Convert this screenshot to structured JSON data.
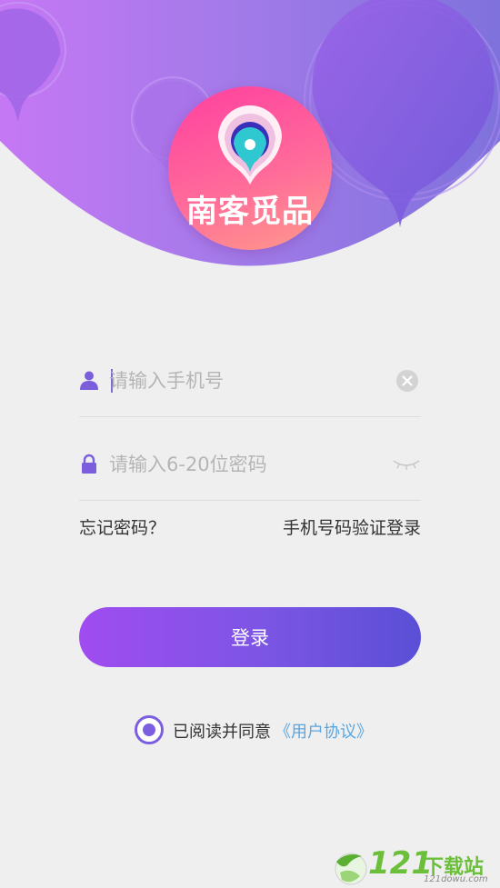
{
  "brand": {
    "name": "南客觅品",
    "colors": {
      "purple_start": "#c070f0",
      "purple_end": "#7f6ee0",
      "logo_pink": "#ff4fa0"
    }
  },
  "login": {
    "phone": {
      "placeholder": "请输入手机号",
      "value": ""
    },
    "password": {
      "placeholder": "请输入6-20位密码",
      "value": ""
    },
    "forgot_label": "忘记密码？",
    "sms_login_label": "手机号码验证登录",
    "submit_label": "登录"
  },
  "agreement": {
    "checked": true,
    "text": "已阅读并同意",
    "link_label": "《用户协议》"
  },
  "watermark": {
    "number": "121",
    "label": "下载站",
    "domain": "121dowu.com"
  },
  "icons": {
    "phone_field": "user-icon",
    "password_field": "lock-icon",
    "clear": "clear-icon",
    "visibility": "eye-closed-icon"
  }
}
